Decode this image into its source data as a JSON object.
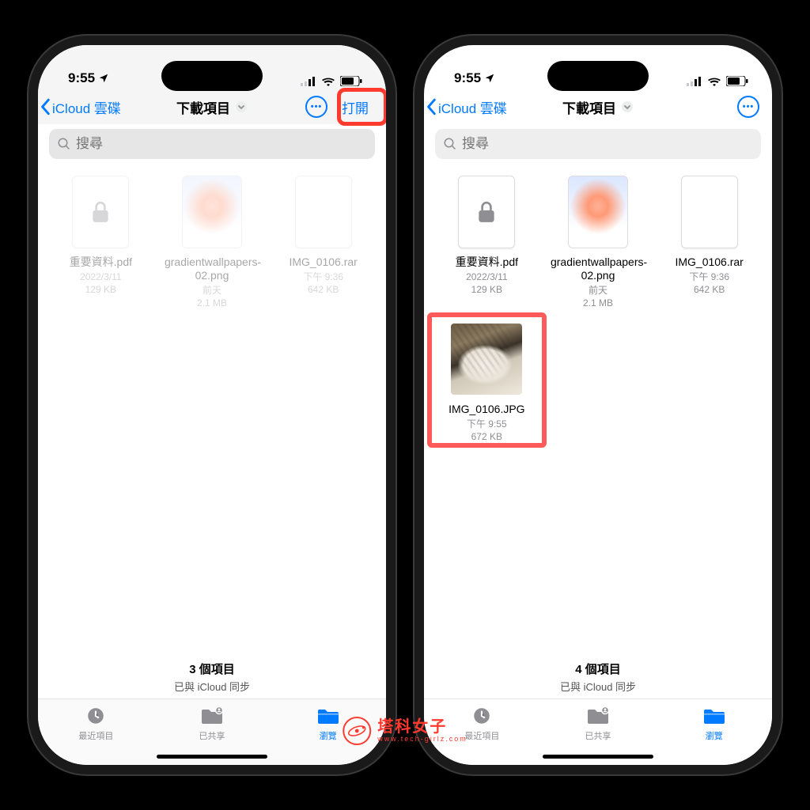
{
  "status": {
    "time": "9:55",
    "location_icon": "location-arrow"
  },
  "nav": {
    "back_label": "iCloud 雲碟",
    "title": "下載項目",
    "open_label": "打開"
  },
  "search": {
    "placeholder": "搜尋"
  },
  "files_left": [
    {
      "name": "重要資料.pdf",
      "date": "2022/3/11",
      "size": "129 KB",
      "kind": "locked-doc"
    },
    {
      "name": "gradientwallpapers-02.png",
      "date": "前天",
      "size": "2.1 MB",
      "kind": "gradient"
    },
    {
      "name": "IMG_0106.rar",
      "date": "下午 9:36",
      "size": "642 KB",
      "kind": "doc"
    }
  ],
  "files_right": [
    {
      "name": "重要資料.pdf",
      "date": "2022/3/11",
      "size": "129 KB",
      "kind": "locked-doc"
    },
    {
      "name": "gradientwallpapers-02.png",
      "date": "前天",
      "size": "2.1 MB",
      "kind": "gradient"
    },
    {
      "name": "IMG_0106.rar",
      "date": "下午 9:36",
      "size": "642 KB",
      "kind": "doc"
    },
    {
      "name": "IMG_0106.JPG",
      "date": "下午 9:55",
      "size": "672 KB",
      "kind": "photo",
      "highlight": true
    }
  ],
  "footer": {
    "left_count": "3 個項目",
    "right_count": "4 個項目",
    "sync": "已與 iCloud 同步"
  },
  "tabs": {
    "recent": "最近項目",
    "shared": "已共享",
    "browse": "瀏覽"
  },
  "watermark": {
    "title": "塔科女子",
    "url": "www.tech-girlz.com"
  }
}
